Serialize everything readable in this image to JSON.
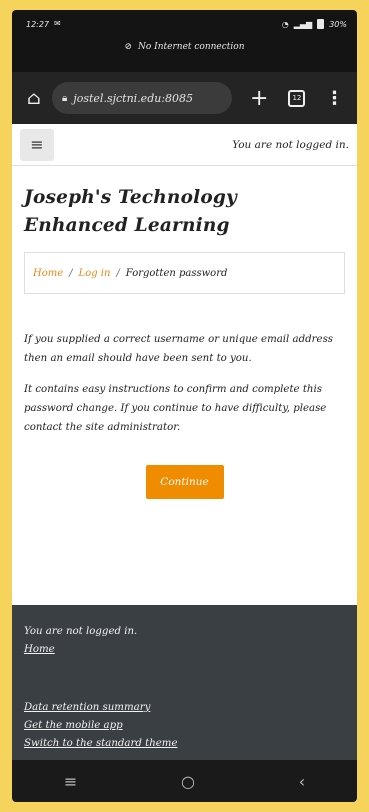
{
  "status_bar": {
    "time": "12:27",
    "left_icon": "notification-icon",
    "right_text": "30%",
    "network_message": "No Internet connection"
  },
  "browser": {
    "url": "jostel.sjctni.edu:8085",
    "tab_count": "12",
    "home_icon": "home-icon",
    "new_tab_icon": "plus-icon",
    "menu_icon": "more-vertical-icon"
  },
  "navbar": {
    "login_status": "You are not logged in."
  },
  "page": {
    "site_title": "Joseph's Technology Enhanced Learning",
    "breadcrumb": {
      "home": "Home",
      "login": "Log in",
      "separator": "/",
      "current": "Forgotten password"
    },
    "message_1": "If you supplied a correct username or unique email address then an email should have been sent to you.",
    "message_2": "It contains easy instructions to confirm and complete this password change. If you continue to have difficulty, please contact the site administrator.",
    "continue_button": "Continue"
  },
  "footer": {
    "login_status": "You are not logged in.",
    "home_link": "Home",
    "data_retention": "Data retention summary",
    "mobile_app": "Get the mobile app",
    "standard_theme": "Switch to the standard theme"
  },
  "colors": {
    "accent": "#f08c00",
    "link": "#e58b15",
    "footer_bg": "#3a3f44",
    "frame": "#f6d35a"
  }
}
